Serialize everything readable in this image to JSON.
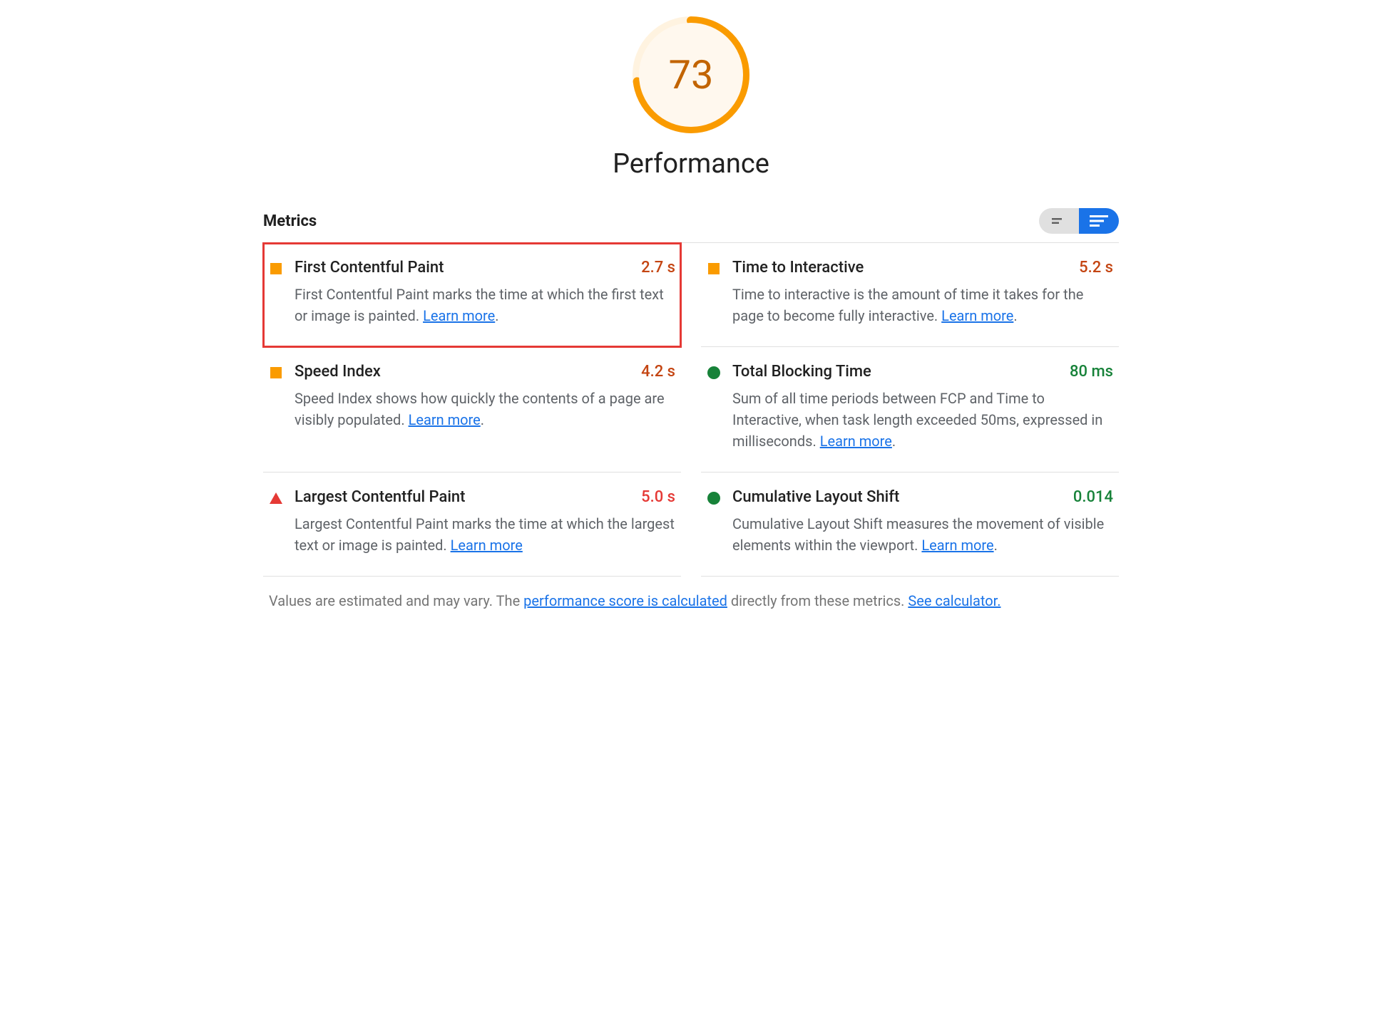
{
  "gauge": {
    "score": "73",
    "percent": 73,
    "color": "#fa9b00",
    "innerBg": "#fff8ee"
  },
  "section_title": "Performance",
  "metrics_heading": "Metrics",
  "metrics": [
    {
      "name": "First Contentful Paint",
      "value": "2.7 s",
      "status": "avg",
      "shape": "square-orange",
      "highlight": true,
      "desc": "First Contentful Paint marks the time at which the first text or image is painted. ",
      "learn": "Learn more",
      "trail": "."
    },
    {
      "name": "Time to Interactive",
      "value": "5.2 s",
      "status": "avg",
      "shape": "square-orange",
      "highlight": false,
      "desc": "Time to interactive is the amount of time it takes for the page to become fully interactive. ",
      "learn": "Learn more",
      "trail": "."
    },
    {
      "name": "Speed Index",
      "value": "4.2 s",
      "status": "avg",
      "shape": "square-orange",
      "highlight": false,
      "desc": "Speed Index shows how quickly the contents of a page are visibly populated. ",
      "learn": "Learn more",
      "trail": "."
    },
    {
      "name": "Total Blocking Time",
      "value": "80 ms",
      "status": "pass",
      "shape": "circle-green",
      "highlight": false,
      "desc": "Sum of all time periods between FCP and Time to Interactive, when task length exceeded 50ms, expressed in milliseconds. ",
      "learn": "Learn more",
      "trail": "."
    },
    {
      "name": "Largest Contentful Paint",
      "value": "5.0 s",
      "status": "fail",
      "shape": "triangle-red",
      "highlight": false,
      "desc": "Largest Contentful Paint marks the time at which the largest text or image is painted. ",
      "learn": "Learn more",
      "trail": ""
    },
    {
      "name": "Cumulative Layout Shift",
      "value": "0.014",
      "status": "pass",
      "shape": "circle-green",
      "highlight": false,
      "desc": "Cumulative Layout Shift measures the movement of visible elements within the viewport. ",
      "learn": "Learn more",
      "trail": "."
    }
  ],
  "footnote": {
    "pre": "Values are estimated and may vary. The ",
    "link1": "performance score is calculated",
    "mid": " directly from these metrics. ",
    "link2": "See calculator."
  }
}
